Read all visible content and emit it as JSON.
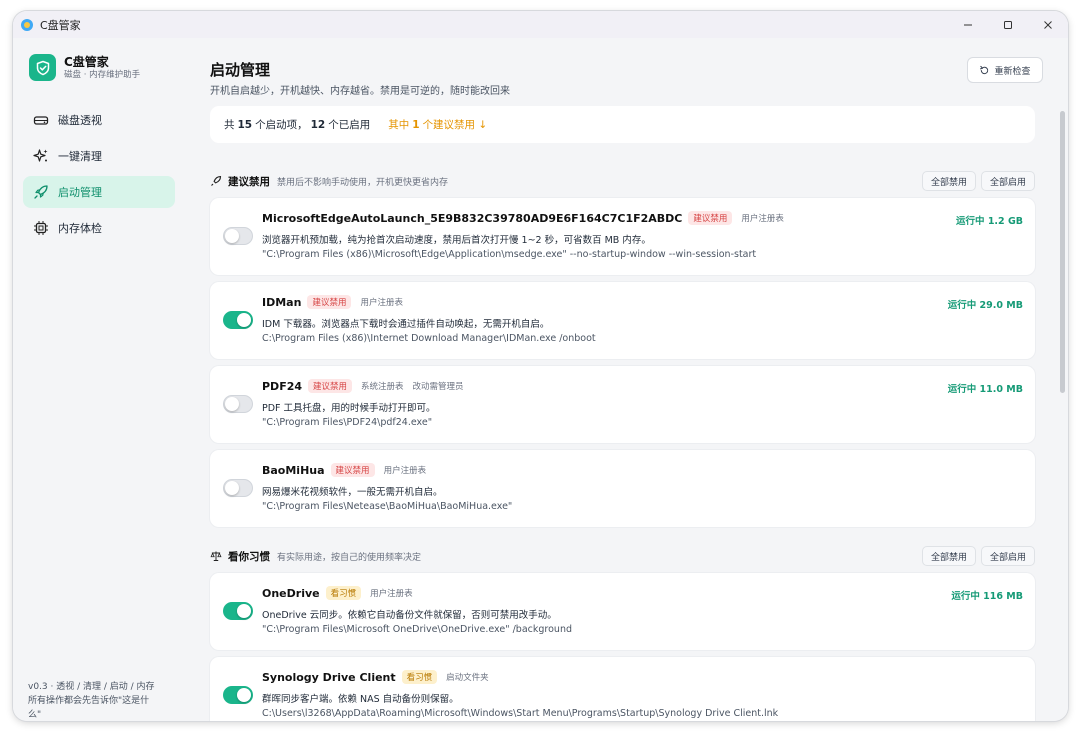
{
  "window": {
    "title": "C盘管家"
  },
  "brand": {
    "name": "C盘管家",
    "subtitle": "磁盘 · 内存维护助手"
  },
  "nav": [
    {
      "label": "磁盘透视",
      "icon": "disk-icon",
      "active": false
    },
    {
      "label": "一键清理",
      "icon": "sparkle-icon",
      "active": false
    },
    {
      "label": "启动管理",
      "icon": "rocket-icon",
      "active": true
    },
    {
      "label": "内存体检",
      "icon": "chip-icon",
      "active": false
    }
  ],
  "footer": {
    "line1": "v0.3 · 透视 / 清理 / 启动 / 内存",
    "line2": "所有操作都会先告诉你\"这是什",
    "line3": "么\""
  },
  "header": {
    "title": "启动管理",
    "subtitle": "开机自启越少，开机越快、内存越省。禁用是可逆的，随时能改回来",
    "recheck_label": "重新检查"
  },
  "summary": {
    "prefix": "共",
    "total": "15",
    "mid": "个启动项，",
    "enabled": "12",
    "suffix": "个已启用",
    "warn_prefix": "其中",
    "warn_count": "1",
    "warn_suffix": "个建议禁用 ↓"
  },
  "sections": [
    {
      "title": "建议禁用",
      "note": "禁用后不影响手动使用，开机更快更省内存",
      "disable_all": "全部禁用",
      "enable_all": "全部启用"
    },
    {
      "title": "看你习惯",
      "note": "有实际用途，按自己的使用频率决定",
      "disable_all": "全部禁用",
      "enable_all": "全部启用"
    }
  ],
  "items": [
    {
      "name": "MicrosoftEdgeAutoLaunch_5E9B832C39780AD9E6F164C7C1F2ABDC",
      "badge": "建议禁用",
      "tags": [
        "用户注册表"
      ],
      "desc": "浏览器开机预加载，纯为抢首次启动速度，禁用后首次打开慢 1~2 秒，可省数百 MB 内存。",
      "cmd": "\"C:\\Program Files (x86)\\Microsoft\\Edge\\Application\\msedge.exe\" --no-startup-window --win-session-start",
      "status": "运行中 1.2 GB",
      "enabled": false
    },
    {
      "name": "IDMan",
      "badge": "建议禁用",
      "tags": [
        "用户注册表"
      ],
      "desc": "IDM 下载器。浏览器点下载时会通过插件自动唤起，无需开机自启。",
      "cmd": "C:\\Program Files (x86)\\Internet Download Manager\\IDMan.exe /onboot",
      "status": "运行中 29.0 MB",
      "enabled": true
    },
    {
      "name": "PDF24",
      "badge": "建议禁用",
      "tags": [
        "系统注册表",
        "改动需管理员"
      ],
      "desc": "PDF 工具托盘，用的时候手动打开即可。",
      "cmd": "\"C:\\Program Files\\PDF24\\pdf24.exe\"",
      "status": "运行中 11.0 MB",
      "enabled": false
    },
    {
      "name": "BaoMiHua",
      "badge": "建议禁用",
      "tags": [
        "用户注册表"
      ],
      "desc": "网易爆米花视频软件，一般无需开机自启。",
      "cmd": "\"C:\\Program Files\\Netease\\BaoMiHua\\BaoMiHua.exe\"",
      "status": "",
      "enabled": false
    },
    {
      "name": "OneDrive",
      "badge": "看习惯",
      "tags": [
        "用户注册表"
      ],
      "desc": "OneDrive 云同步。依赖它自动备份文件就保留，否则可禁用改手动。",
      "cmd": "\"C:\\Program Files\\Microsoft OneDrive\\OneDrive.exe\" /background",
      "status": "运行中 116 MB",
      "enabled": true
    },
    {
      "name": "Synology Drive Client",
      "badge": "看习惯",
      "tags": [
        "启动文件夹"
      ],
      "desc": "群晖同步客户端。依赖 NAS 自动备份则保留。",
      "cmd": "C:\\Users\\l3268\\AppData\\Roaming\\Microsoft\\Windows\\Start Menu\\Programs\\Startup\\Synology Drive Client.lnk",
      "status": "",
      "enabled": true
    }
  ],
  "colors": {
    "accent": "#1ab58b",
    "warn": "#e59400",
    "danger": "#d64545"
  }
}
